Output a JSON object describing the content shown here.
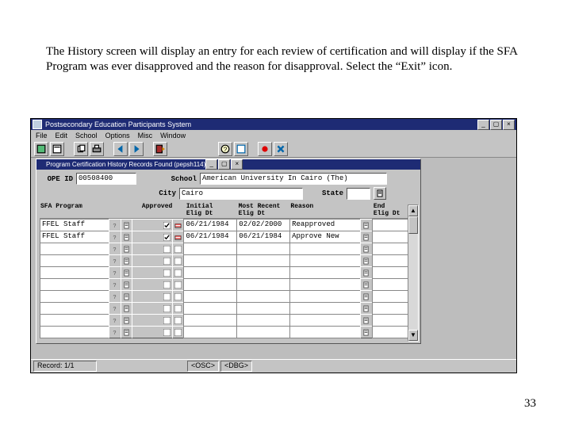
{
  "intro": "The History screen will display an entry for each review of certification and will display if the SFA Program was ever disapproved and the reason for disapproval. Select the “Exit” icon.",
  "page_number": "33",
  "app": {
    "title": "Postsecondary Education Participants System",
    "menu": [
      "File",
      "Edit",
      "School",
      "Options",
      "Misc",
      "Window"
    ],
    "inner_title": "Program Certification History Records Found (pepsh114)",
    "labels": {
      "ope_id": "OPE ID",
      "school": "School",
      "city": "City",
      "state": "State"
    },
    "fields": {
      "ope_id": "00508400",
      "school": "American University In Cairo (The)",
      "city": "Cairo",
      "state": ""
    },
    "columns": {
      "sfa": "SFA Program",
      "approved": "Approved",
      "initial": "Initial\nElig Dt",
      "most_recent": "Most Recent\nElig Dt",
      "reason": "Reason",
      "end": "End\nElig Dt"
    },
    "rows": [
      {
        "sfa": "FFEL Staff",
        "approved": true,
        "initial": "06/21/1984",
        "most_recent": "02/02/2000",
        "reason": "Reapproved",
        "end": ""
      },
      {
        "sfa": "FFEL Staff",
        "approved": true,
        "initial": "06/21/1984",
        "most_recent": "06/21/1984",
        "reason": "Approve New",
        "end": ""
      },
      {
        "sfa": "",
        "approved": null,
        "initial": "",
        "most_recent": "",
        "reason": "",
        "end": ""
      },
      {
        "sfa": "",
        "approved": null,
        "initial": "",
        "most_recent": "",
        "reason": "",
        "end": ""
      },
      {
        "sfa": "",
        "approved": null,
        "initial": "",
        "most_recent": "",
        "reason": "",
        "end": ""
      },
      {
        "sfa": "",
        "approved": null,
        "initial": "",
        "most_recent": "",
        "reason": "",
        "end": ""
      },
      {
        "sfa": "",
        "approved": null,
        "initial": "",
        "most_recent": "",
        "reason": "",
        "end": ""
      },
      {
        "sfa": "",
        "approved": null,
        "initial": "",
        "most_recent": "",
        "reason": "",
        "end": ""
      },
      {
        "sfa": "",
        "approved": null,
        "initial": "",
        "most_recent": "",
        "reason": "",
        "end": ""
      },
      {
        "sfa": "",
        "approved": null,
        "initial": "",
        "most_recent": "",
        "reason": "",
        "end": ""
      }
    ],
    "status": {
      "record": "Record: 1/1",
      "osc": "<OSC>",
      "dbg": "<DBG>"
    }
  }
}
